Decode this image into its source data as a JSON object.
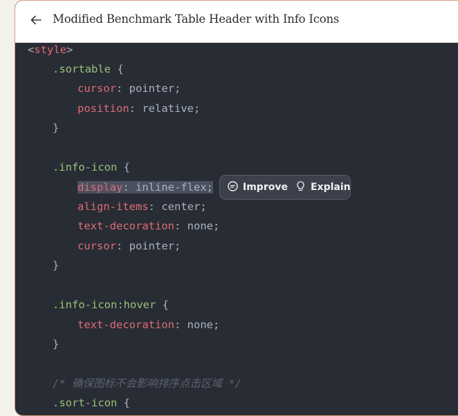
{
  "header": {
    "title": "Modified Benchmark Table Header with Info Icons",
    "back_icon": "arrow-left-icon"
  },
  "code": {
    "lines": [
      "<style>",
      ".sortable {",
      "cursor: pointer;",
      "position: relative;",
      "}",
      "",
      ".info-icon {",
      "display: inline-flex;",
      "align-items: center;",
      "text-decoration: none;",
      "cursor: pointer;",
      "}",
      "",
      ".info-icon:hover {",
      "text-decoration: none;",
      "}",
      "",
      "/* 确保图标不会影响排序点击区域 */",
      ".sort-icon {"
    ]
  },
  "popup": {
    "improve_label": "Improve",
    "improve_icon": "chat-bubble-icon",
    "explain_label": "Explain",
    "explain_icon": "lightbulb-icon"
  }
}
